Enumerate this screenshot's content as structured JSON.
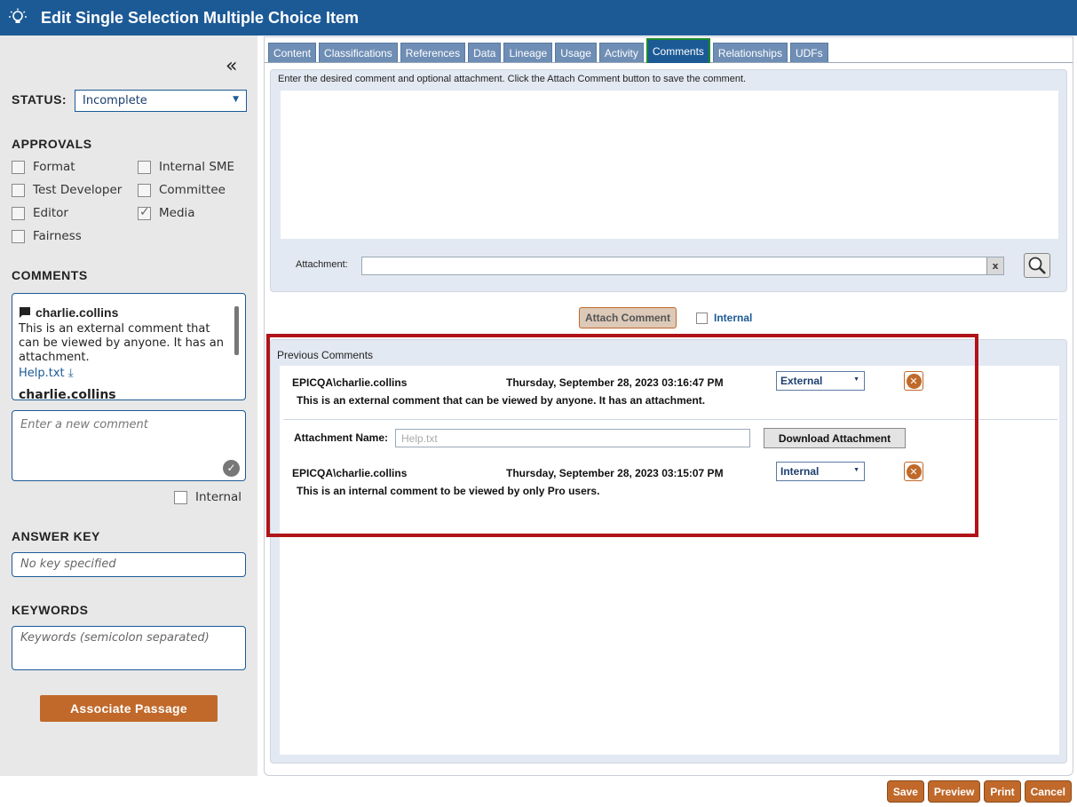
{
  "window": {
    "title": "Edit Single Selection Multiple Choice Item"
  },
  "sidebar": {
    "status_label": "STATUS:",
    "status_value": "Incomplete",
    "approvals_label": "APPROVALS",
    "approvals": [
      {
        "label": "Format",
        "checked": false
      },
      {
        "label": "Internal SME",
        "checked": false
      },
      {
        "label": "Test Developer",
        "checked": false
      },
      {
        "label": "Committee",
        "checked": false
      },
      {
        "label": "Editor",
        "checked": false
      },
      {
        "label": "Media",
        "checked": true
      },
      {
        "label": "Fairness",
        "checked": false
      }
    ],
    "comments_label": "COMMENTS",
    "comment": {
      "author": "charlie.collins",
      "text": "This is an external comment that can be viewed by anyone. It has an attachment.",
      "attachment": "Help.txt"
    },
    "comment_peek": "charlie.collins",
    "new_comment_placeholder": "Enter a new comment",
    "internal_label": "Internal",
    "answer_key_label": "ANSWER KEY",
    "answer_key_placeholder": "No key specified",
    "keywords_label": "KEYWORDS",
    "keywords_placeholder": "Keywords (semicolon separated)",
    "associate_button": "Associate Passage"
  },
  "tabs": [
    {
      "label": "Content",
      "active": false
    },
    {
      "label": "Classifications",
      "active": false
    },
    {
      "label": "References",
      "active": false
    },
    {
      "label": "Data",
      "active": false
    },
    {
      "label": "Lineage",
      "active": false
    },
    {
      "label": "Usage",
      "active": false
    },
    {
      "label": "Activity",
      "active": false
    },
    {
      "label": "Comments",
      "active": true
    },
    {
      "label": "Relationships",
      "active": false
    },
    {
      "label": "UDFs",
      "active": false
    }
  ],
  "editor": {
    "instruction": "Enter the desired comment and optional attachment. Click the Attach Comment button to save the comment.",
    "attachment_label": "Attachment:",
    "attachment_clear": "x",
    "attach_button": "Attach Comment",
    "internal_label": "Internal"
  },
  "previous": {
    "label": "Previous Comments",
    "items": [
      {
        "author": "EPICQA\\charlie.collins",
        "date": "Thursday, September 28, 2023 03:16:47 PM",
        "visibility": "External",
        "text": "This is an external comment that can be viewed by anyone.  It has an attachment."
      },
      {
        "author": "EPICQA\\charlie.collins",
        "date": "Thursday, September 28, 2023 03:15:07 PM",
        "visibility": "Internal",
        "text": "This is an internal comment to be viewed by only Pro users."
      }
    ],
    "attachment_name_label": "Attachment Name:",
    "attachment_name_value": "Help.txt",
    "download_button": "Download Attachment"
  },
  "footer": {
    "save": "Save",
    "preview": "Preview",
    "print": "Print",
    "cancel": "Cancel"
  },
  "colors": {
    "titlebar": "#1c5a96",
    "accent_orange": "#c0692a",
    "highlight_red": "#b01419",
    "active_tab_border": "#1e8a2e"
  }
}
